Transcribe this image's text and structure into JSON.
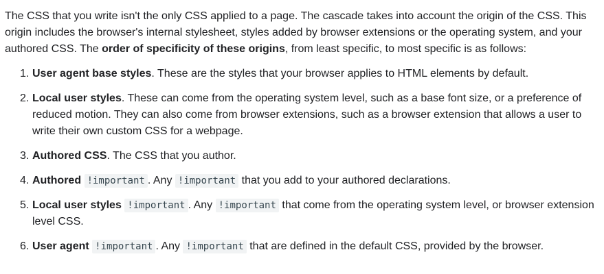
{
  "intro": {
    "part1": "The CSS that you write isn't the only CSS applied to a page. The cascade takes into account the origin of the CSS. This origin includes the browser's internal stylesheet, styles added by browser extensions or the operating system, and your authored CSS. The ",
    "bold": "order of specificity of these origins",
    "part2": ", from least specific, to most specific is as follows:"
  },
  "items": [
    {
      "num": "1.",
      "bold": "User agent base styles",
      "text": ". These are the styles that your browser applies to HTML elements by default."
    },
    {
      "num": "2.",
      "bold": "Local user styles",
      "text": ". These can come from the operating system level, such as a base font size, or a preference of reduced motion. They can also come from browser extensions, such as a browser extension that allows a user to write their own custom CSS for a webpage."
    },
    {
      "num": "3.",
      "bold": "Authored CSS",
      "text": ". The CSS that you author."
    },
    {
      "num": "4.",
      "bold": "Authored",
      "code1": "!important",
      "text1": ". Any ",
      "code2": "!important",
      "text2": " that you add to your authored declarations."
    },
    {
      "num": "5.",
      "bold": "Local user styles",
      "code1": "!important",
      "text1": ". Any ",
      "code2": "!important",
      "text2": " that come from the operating system level, or browser extension level CSS."
    },
    {
      "num": "6.",
      "bold": "User agent",
      "code1": "!important",
      "text1": ". Any ",
      "code2": "!important",
      "text2": " that are defined in the default CSS, provided by the browser."
    }
  ]
}
